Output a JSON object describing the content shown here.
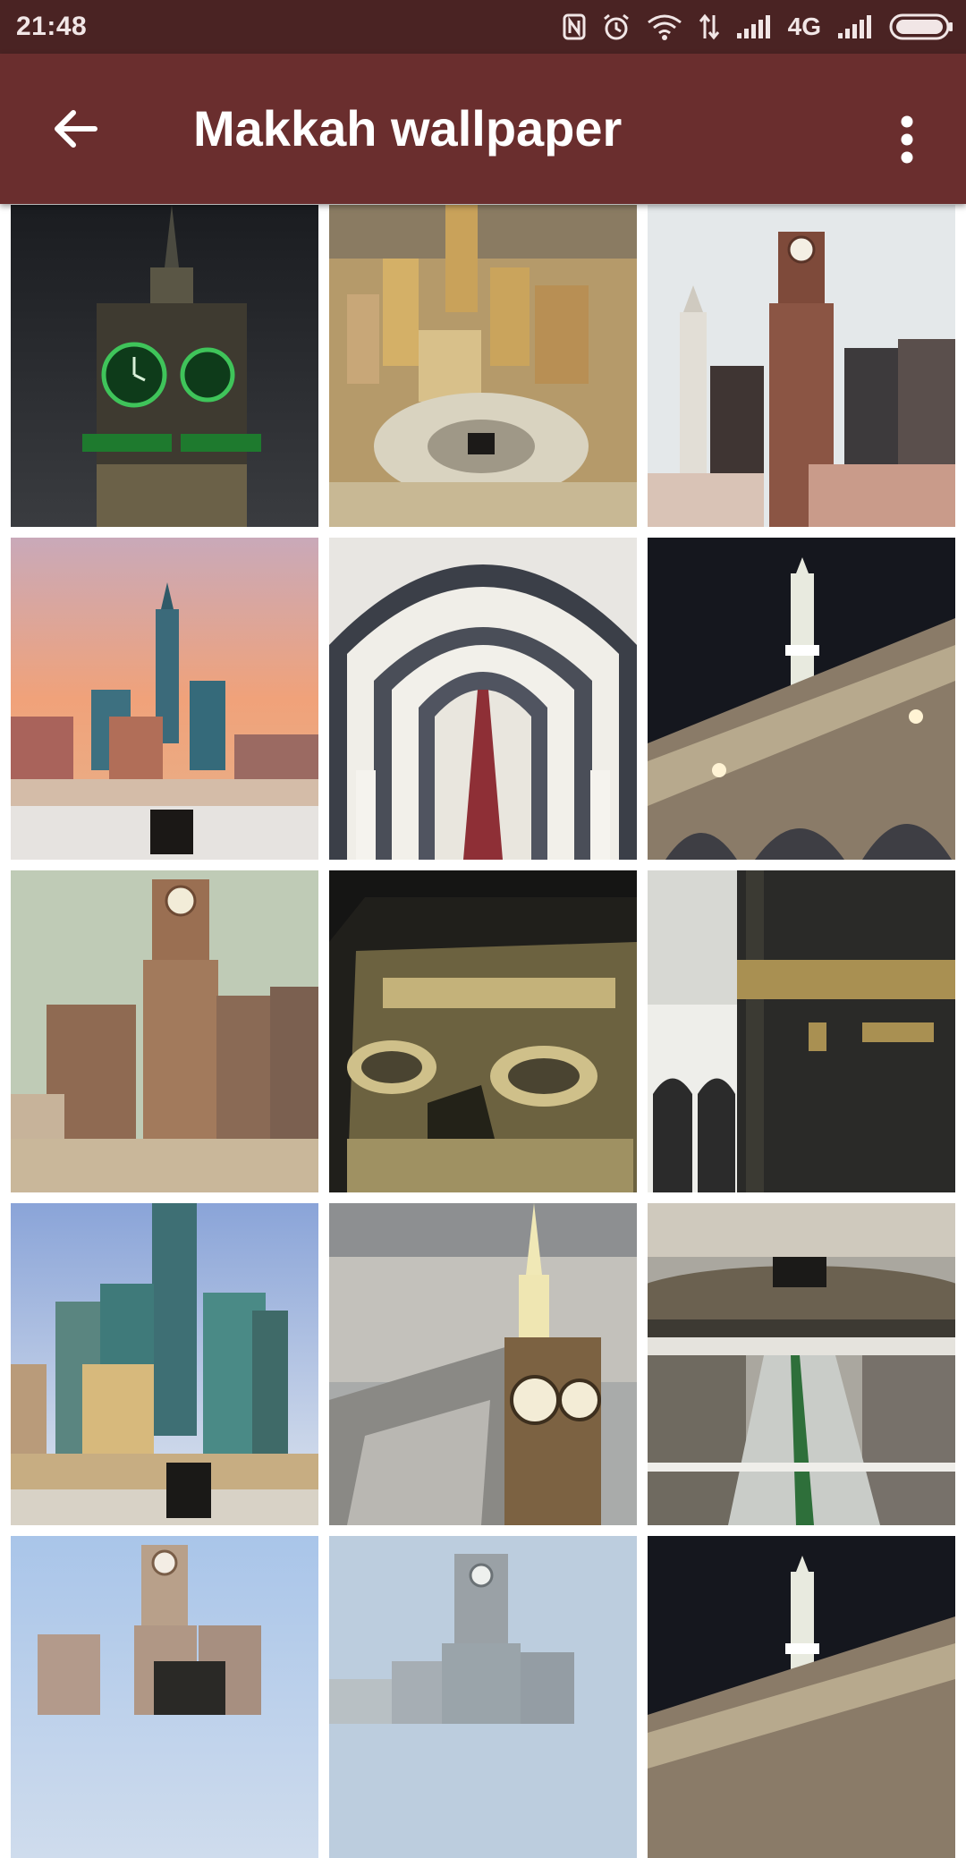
{
  "status_bar": {
    "time": "21:48",
    "network_label": "4G",
    "icons": [
      "nfc-icon",
      "alarm-icon",
      "wifi-icon",
      "data-transfer-icon",
      "signal-icon",
      "signal-icon",
      "battery-icon"
    ]
  },
  "app_bar": {
    "title": "Makkah wallpaper",
    "back_icon": "arrow-left-icon",
    "menu_icon": "more-vertical-icon",
    "background_color": "#6a2e2e",
    "status_color": "#4a2323"
  },
  "wallpapers": [
    {
      "subject": "clock tower at night",
      "icon": "clock-tower-icon"
    },
    {
      "subject": "aerial city view",
      "icon": "city-icon"
    },
    {
      "subject": "clock tower towers",
      "icon": "clock-tower-icon"
    },
    {
      "subject": "sunset towers and kaaba",
      "icon": "city-icon"
    },
    {
      "subject": "mosque arches",
      "icon": "arches-icon"
    },
    {
      "subject": "minaret at night",
      "icon": "minaret-icon"
    },
    {
      "subject": "clock tower complex",
      "icon": "clock-tower-icon"
    },
    {
      "subject": "kaaba kiswa embroidery",
      "icon": "kiswa-icon"
    },
    {
      "subject": "kaaba corner",
      "icon": "kaaba-icon"
    },
    {
      "subject": "towers and kaaba",
      "icon": "city-icon"
    },
    {
      "subject": "clock tower aerial",
      "icon": "clock-tower-icon"
    },
    {
      "subject": "crowd around kaaba",
      "icon": "crowd-icon"
    },
    {
      "subject": "clock tower blue sky",
      "icon": "clock-tower-icon"
    },
    {
      "subject": "clock tower haze",
      "icon": "clock-tower-icon"
    },
    {
      "subject": "minaret at night",
      "icon": "minaret-icon"
    }
  ]
}
